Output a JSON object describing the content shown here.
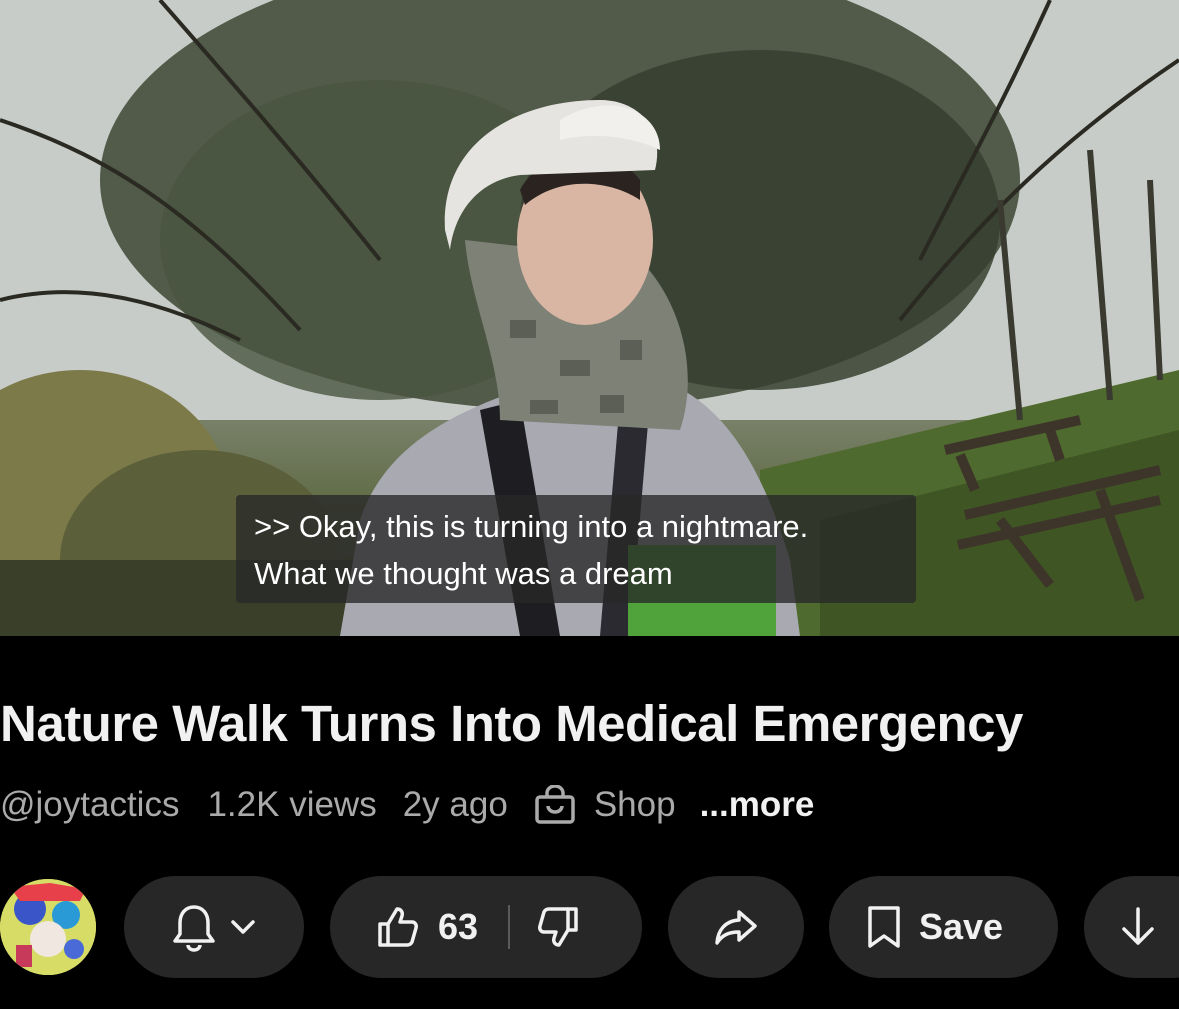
{
  "video": {
    "caption_line1": ">> Okay, this is turning into a nightmare.",
    "caption_line2": "What we thought was a dream"
  },
  "title": "Nature Walk Turns Into Medical Emergency",
  "meta": {
    "channel": "@joytactics",
    "views": "1.2K views",
    "age": "2y ago",
    "shop_label": "Shop",
    "more_label": "...more"
  },
  "actions": {
    "like_count": "63",
    "save_label": "Save",
    "icons": [
      "bell-icon",
      "chevron-down-icon",
      "thumbs-up-icon",
      "thumbs-down-icon",
      "share-icon",
      "bookmark-icon",
      "download-icon"
    ]
  },
  "colors": {
    "background": "#000000",
    "pill": "#272727",
    "secondary_text": "#aaaaaa",
    "primary_text": "#f1f1f1"
  }
}
